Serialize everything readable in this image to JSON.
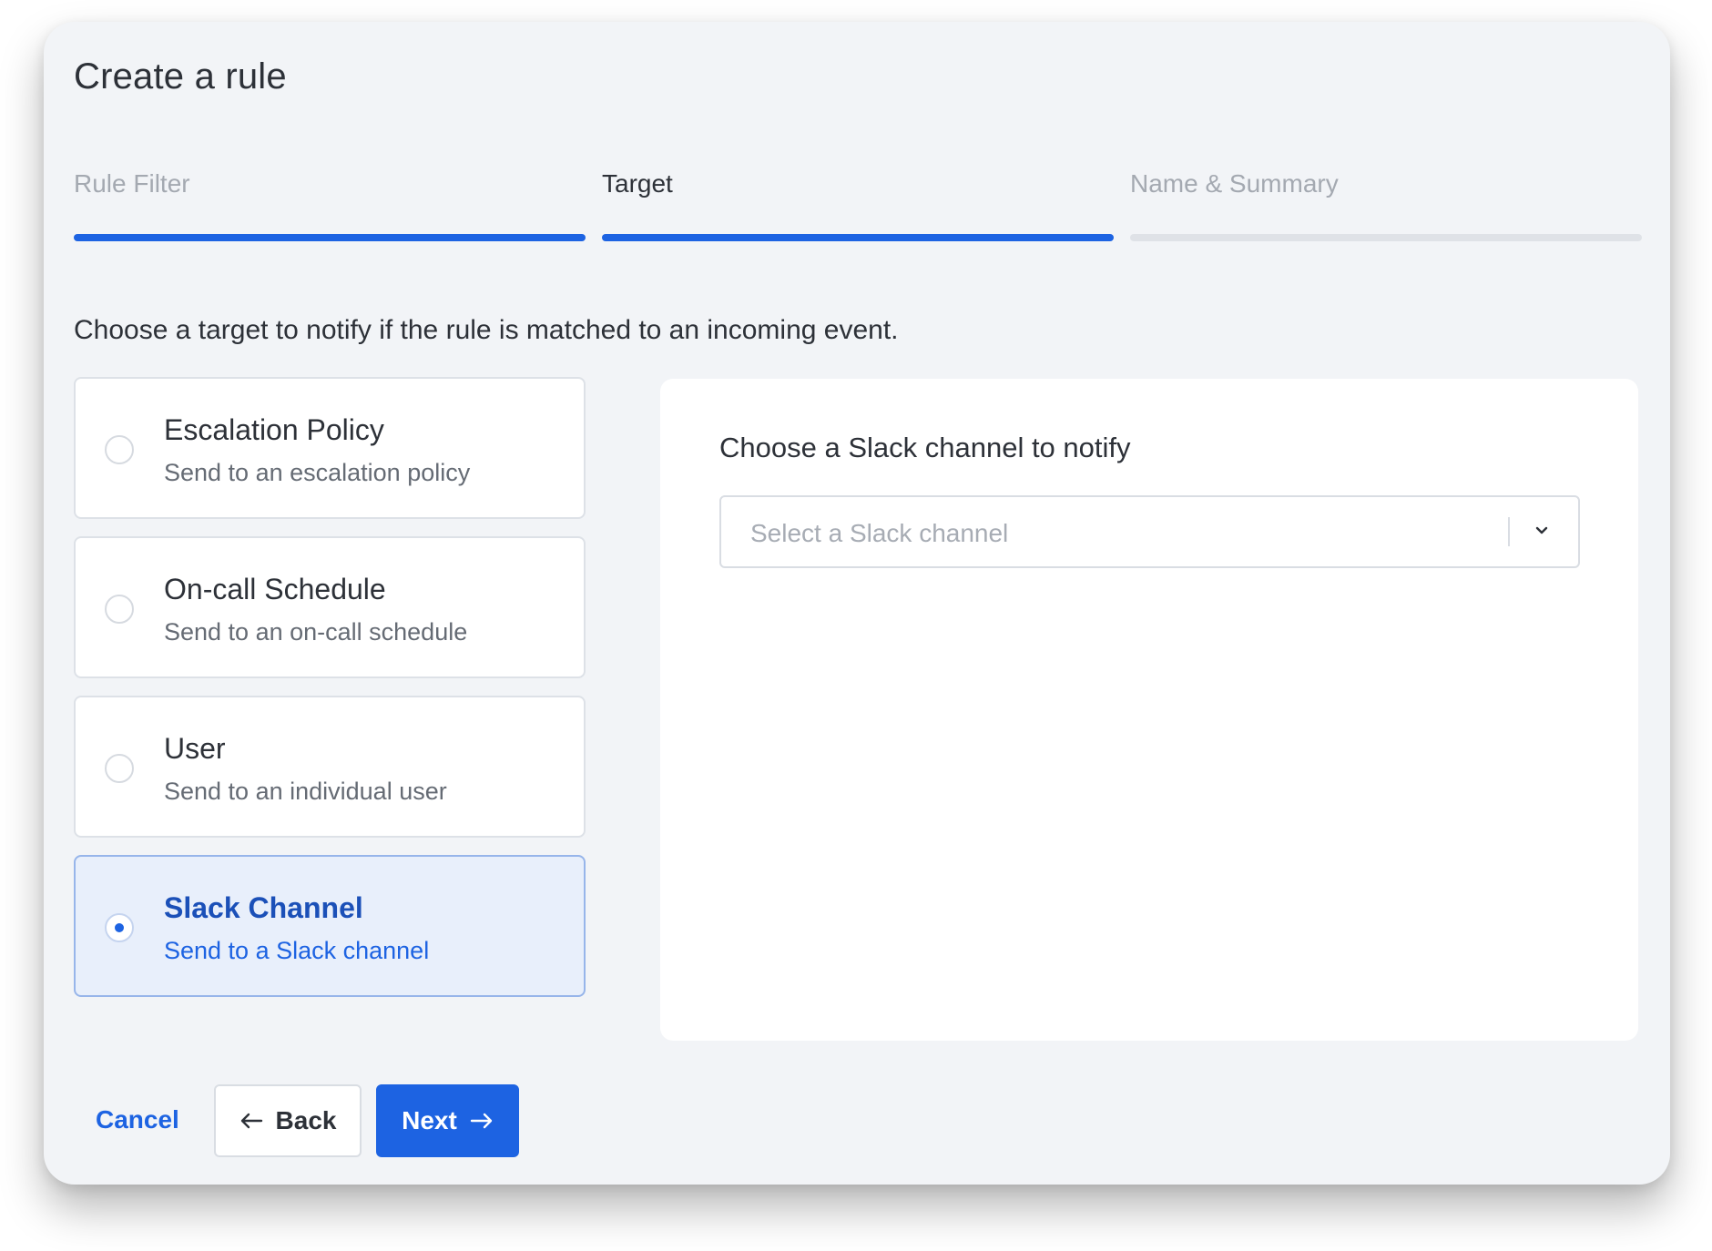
{
  "modal": {
    "title": "Create a rule"
  },
  "steps": [
    {
      "label": "Rule Filter",
      "state": "done"
    },
    {
      "label": "Target",
      "state": "current"
    },
    {
      "label": "Name & Summary",
      "state": "upcoming"
    }
  ],
  "instructions": "Choose a target to notify if the rule is matched to an incoming event.",
  "targets": [
    {
      "title": "Escalation Policy",
      "description": "Send to an escalation policy",
      "selected": false
    },
    {
      "title": "On-call Schedule",
      "description": "Send to an on-call schedule",
      "selected": false
    },
    {
      "title": "User",
      "description": "Send to an individual user",
      "selected": false
    },
    {
      "title": "Slack Channel",
      "description": "Send to a Slack channel",
      "selected": true
    }
  ],
  "panel": {
    "label": "Choose a Slack channel to notify",
    "select_placeholder": "Select a Slack channel",
    "select_icon": "chevron-down-icon"
  },
  "footer": {
    "cancel_label": "Cancel",
    "back_label": "Back",
    "back_icon": "arrow-left-icon",
    "next_label": "Next",
    "next_icon": "arrow-right-icon"
  },
  "colors": {
    "accent": "#1d63e2",
    "selected_bg": "#e8effb",
    "modal_bg": "#f2f4f7"
  }
}
